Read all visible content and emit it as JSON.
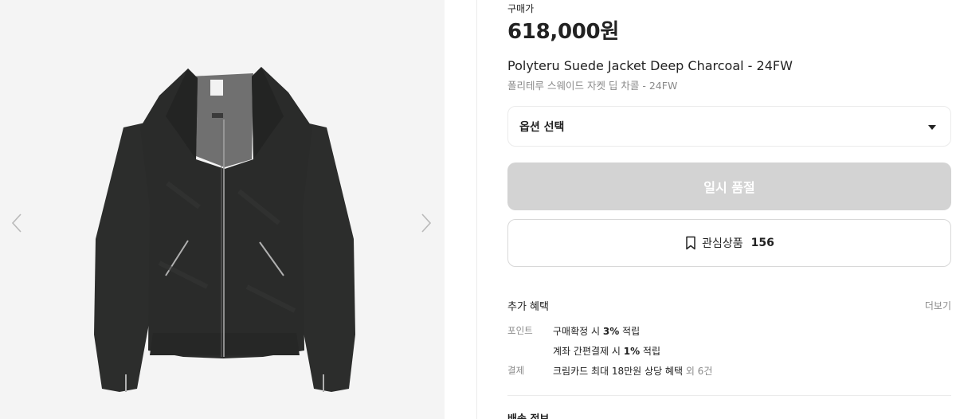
{
  "product": {
    "price_label": "구매가",
    "price": "618,000원",
    "name_en": "Polyteru Suede Jacket Deep Charcoal - 24FW",
    "name_ko": "폴리테루 스웨이드 자켓 딥 차콜 - 24FW"
  },
  "option": {
    "label": "옵션 선택",
    "icon": "caret-down-icon"
  },
  "buy": {
    "label": "일시 품절"
  },
  "wish": {
    "label": "관심상품",
    "count": "156",
    "icon": "bookmark-icon"
  },
  "benefits": {
    "title": "추가 혜택",
    "more": "더보기",
    "rows": [
      {
        "key": "포인트",
        "pre": "구매확정 시 ",
        "bold": "3%",
        "post": " 적립",
        "sub": ""
      },
      {
        "key": "",
        "pre": "계좌 간편결제 시 ",
        "bold": "1%",
        "post": " 적립",
        "sub": ""
      },
      {
        "key": "결제",
        "pre": "크림카드 최대 18만원 상당 혜택 ",
        "bold": "",
        "post": "",
        "sub": "외 6건"
      }
    ]
  },
  "next_section": {
    "title": "배송 정보"
  },
  "gallery": {
    "prev_icon": "chevron-left-icon",
    "next_icon": "chevron-right-icon"
  },
  "colors": {
    "soldout_bg": "#d3d3d3",
    "gallery_bg": "#f4f4f4",
    "jacket": "#2a2b2a",
    "lining": "#6e6e6e"
  }
}
